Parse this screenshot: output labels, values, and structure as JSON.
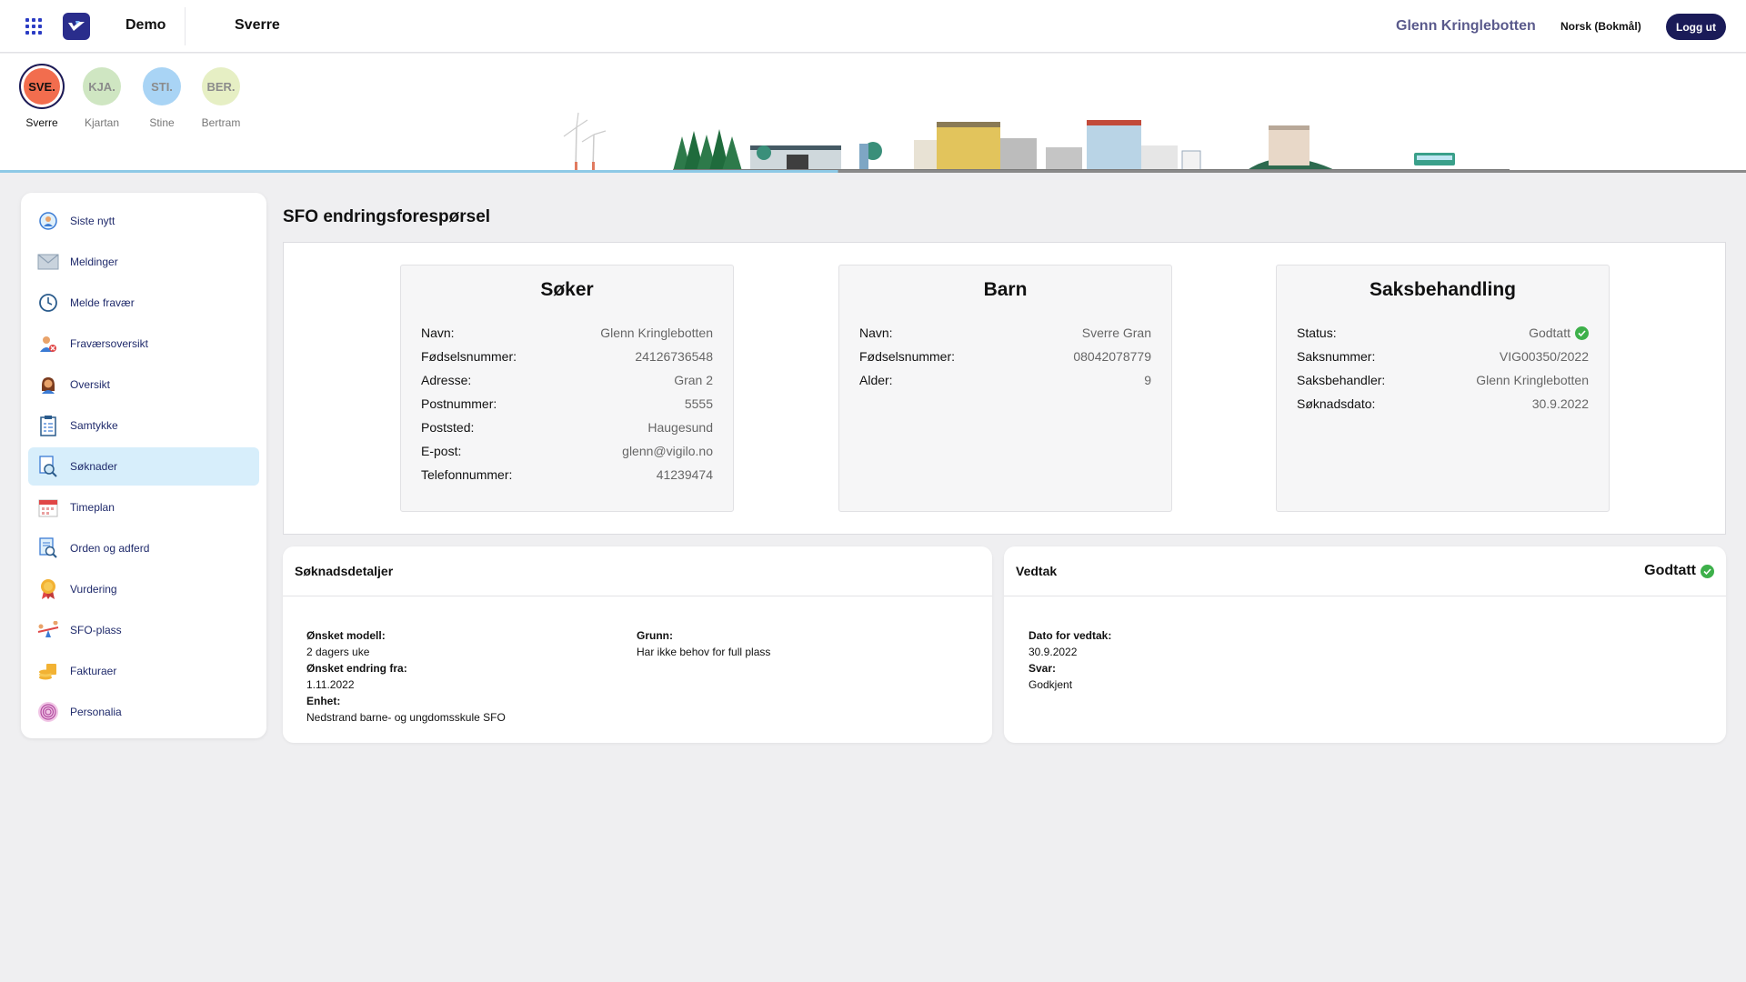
{
  "topbar": {
    "org": "Demo",
    "child": "Sverre",
    "user": "Glenn Kringlebotten",
    "language": "Norsk (Bokmål)",
    "logout": "Logg ut"
  },
  "children": [
    {
      "initials": "SVE.",
      "name": "Sverre",
      "color": "#f26d4e",
      "active": true
    },
    {
      "initials": "KJA.",
      "name": "Kjartan",
      "color": "#cfe6c2",
      "active": false
    },
    {
      "initials": "STI.",
      "name": "Stine",
      "color": "#a9d4f5",
      "active": false
    },
    {
      "initials": "BER.",
      "name": "Bertram",
      "color": "#e6efc4",
      "active": false
    }
  ],
  "sidebar": {
    "items": [
      {
        "label": "Siste nytt",
        "icon": "news-icon"
      },
      {
        "label": "Meldinger",
        "icon": "envelope-icon"
      },
      {
        "label": "Melde fravær",
        "icon": "clock-icon"
      },
      {
        "label": "Fraværsoversikt",
        "icon": "person-absence-icon"
      },
      {
        "label": "Oversikt",
        "icon": "person-icon"
      },
      {
        "label": "Samtykke",
        "icon": "clipboard-icon"
      },
      {
        "label": "Søknader",
        "icon": "document-search-icon",
        "active": true
      },
      {
        "label": "Timeplan",
        "icon": "calendar-icon"
      },
      {
        "label": "Orden og adferd",
        "icon": "document-magnify-icon"
      },
      {
        "label": "Vurdering",
        "icon": "medal-icon"
      },
      {
        "label": "SFO-plass",
        "icon": "seesaw-icon"
      },
      {
        "label": "Fakturaer",
        "icon": "coins-icon"
      },
      {
        "label": "Personalia",
        "icon": "fingerprint-icon"
      }
    ]
  },
  "page": {
    "title": "SFO endringsforespørsel"
  },
  "soker": {
    "heading": "Søker",
    "rows": [
      {
        "k": "Navn:",
        "v": "Glenn Kringlebotten"
      },
      {
        "k": "Fødselsnummer:",
        "v": "24126736548"
      },
      {
        "k": "Adresse:",
        "v": "Gran 2"
      },
      {
        "k": "Postnummer:",
        "v": "5555"
      },
      {
        "k": "Poststed:",
        "v": "Haugesund"
      },
      {
        "k": "E-post:",
        "v": "glenn@vigilo.no"
      },
      {
        "k": "Telefonnummer:",
        "v": "41239474"
      }
    ]
  },
  "barn": {
    "heading": "Barn",
    "rows": [
      {
        "k": "Navn:",
        "v": "Sverre Gran"
      },
      {
        "k": "Fødselsnummer:",
        "v": "08042078779"
      },
      {
        "k": "Alder:",
        "v": "9"
      }
    ]
  },
  "saksbehandling": {
    "heading": "Saksbehandling",
    "rows": [
      {
        "k": "Status:",
        "v": "Godtatt"
      },
      {
        "k": "Saksnummer:",
        "v": "VIG00350/2022"
      },
      {
        "k": "Saksbehandler:",
        "v": "Glenn Kringlebotten"
      },
      {
        "k": "Søknadsdato:",
        "v": "30.9.2022"
      }
    ]
  },
  "soknadsdetaljer": {
    "title": "Søknadsdetaljer",
    "modell_label": "Ønsket modell:",
    "modell_value": "2 dagers uke",
    "endring_label": "Ønsket endring fra:",
    "endring_value": "1.11.2022",
    "enhet_label": "Enhet:",
    "enhet_value": "Nedstrand barne- og ungdomsskule SFO",
    "grunn_label": "Grunn:",
    "grunn_value": "Har ikke behov for full plass"
  },
  "vedtak": {
    "title": "Vedtak",
    "status": "Godtatt",
    "dato_label": "Dato for vedtak:",
    "dato_value": "30.9.2022",
    "svar_label": "Svar:",
    "svar_value": "Godkjent"
  },
  "colors": {
    "accent": "#1a1b58",
    "active_nav": "#d7eefb",
    "success": "#3db04a"
  }
}
